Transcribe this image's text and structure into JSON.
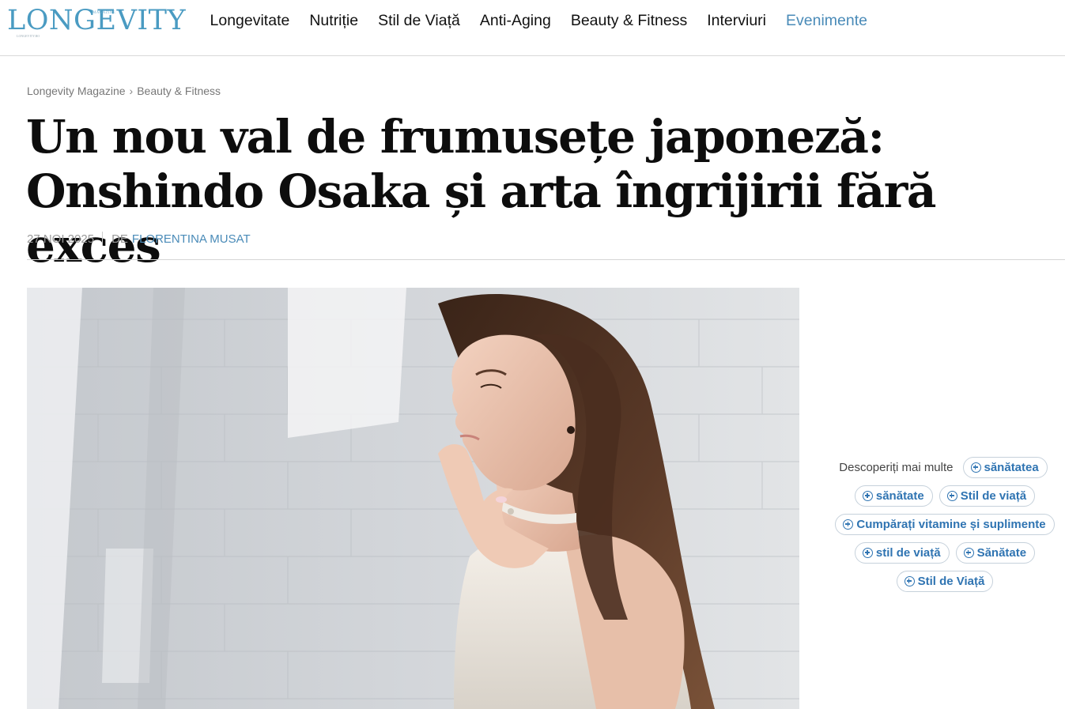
{
  "site": {
    "logo_text": "LONGEVITY",
    "logo_badge": "MAGAZINE",
    "logo_sub": "LONGEVITY.RO"
  },
  "nav": {
    "items": [
      {
        "label": "Longevitate"
      },
      {
        "label": "Nutriție"
      },
      {
        "label": "Stil de Viață"
      },
      {
        "label": "Anti-Aging"
      },
      {
        "label": "Beauty & Fitness"
      },
      {
        "label": "Interviuri"
      },
      {
        "label": "Evenimente"
      }
    ]
  },
  "breadcrumb": {
    "home": "Longevity Magazine",
    "separator": "›",
    "current": "Beauty & Fitness"
  },
  "article": {
    "title": "Un nou val de frumusețe japoneză: Onshindo Osaka și arta îngrijirii fără exces",
    "date": "27 NOI 2025",
    "by": "DE",
    "author": "FLORENTINA MUSAT"
  },
  "discover": {
    "label": "Descoperiți mai multe",
    "chips": [
      "sănătatea",
      "sănătate",
      "Stil de viață",
      "Cumpărați vitamine și suplimente",
      "stil de viață",
      "Sănătate",
      "Stil de Viață"
    ]
  },
  "colors": {
    "accent": "#4a8bb8",
    "logo": "#4a9bc2",
    "chip_text": "#2f74b2"
  }
}
